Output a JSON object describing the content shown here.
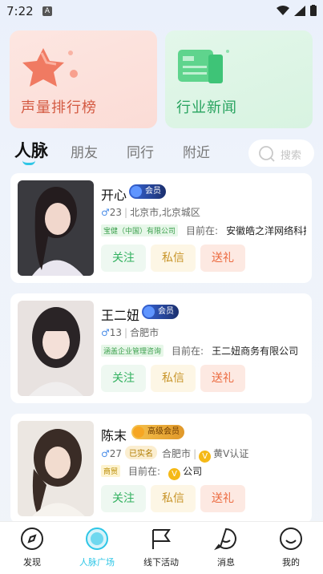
{
  "status_bar": {
    "time": "7:22",
    "notification_icon": "A"
  },
  "top_cards": [
    {
      "title": "声量排行榜",
      "icon": "star-icon"
    },
    {
      "title": "行业新闻",
      "icon": "newspaper-icon"
    }
  ],
  "tabs": [
    {
      "label": "人脉",
      "active": true
    },
    {
      "label": "朋友",
      "active": false
    },
    {
      "label": "同行",
      "active": false
    },
    {
      "label": "附近",
      "active": false
    }
  ],
  "search": {
    "placeholder": "搜索"
  },
  "people": [
    {
      "name": "开心",
      "badge": "会员",
      "age": "23",
      "location": "北京市,北京城区",
      "tag": "宝健（中国）有限公司",
      "current_label": "目前在:",
      "company": "安徽皓之洋网络科技",
      "follow": "关注",
      "message": "私信",
      "gift": "送礼"
    },
    {
      "name": "王二妞",
      "badge": "会员",
      "age": "13",
      "location": "合肥市",
      "tag": "涵盖企业管理咨询",
      "current_label": "目前在:",
      "company": "王二妞商务有限公司",
      "follow": "关注",
      "message": "私信",
      "gift": "送礼"
    },
    {
      "name": "陈末",
      "badge": "高级会员",
      "age": "27",
      "verified": "已实名",
      "location": "合肥市",
      "v_label": "黄V认证",
      "tag": "商贸",
      "current_label": "目前在:",
      "company": "公司",
      "follow": "关注",
      "message": "私信",
      "gift": "送礼"
    }
  ],
  "bottom_nav": [
    {
      "label": "发现",
      "icon": "compass-icon"
    },
    {
      "label": "人脉广场",
      "icon": "connections-icon",
      "active": true
    },
    {
      "label": "线下活动",
      "icon": "flag-icon"
    },
    {
      "label": "消息",
      "icon": "chat-bubble-icon"
    },
    {
      "label": "我的",
      "icon": "smiley-icon"
    }
  ],
  "colors": {
    "accent": "#2ec6e6",
    "follow": "#32b160",
    "message": "#c8952a",
    "gift": "#ec6a3f"
  }
}
